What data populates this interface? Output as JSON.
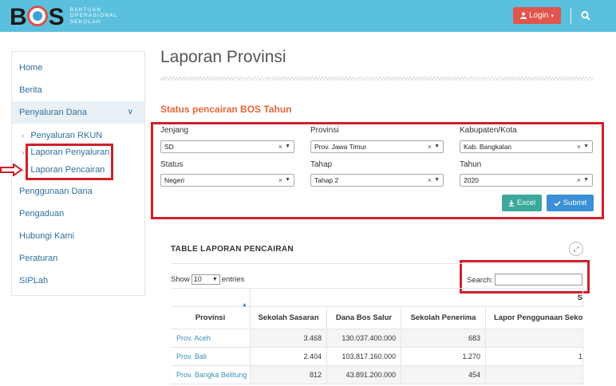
{
  "header": {
    "logo": "BOS",
    "logo_sub": [
      "BANTUAN",
      "OPERASIONAL",
      "SEKOLAH"
    ],
    "login_label": "Login",
    "colors": {
      "bar": "#5bc0de",
      "login": "#e0554d"
    }
  },
  "sidebar": {
    "items": [
      {
        "label": "Home"
      },
      {
        "label": "Berita"
      },
      {
        "label": "Penyaluran Dana"
      },
      {
        "label": "Penggunaan Dana"
      },
      {
        "label": "Pengaduan"
      },
      {
        "label": "Hubungi Kami"
      },
      {
        "label": "Peraturan"
      },
      {
        "label": "SIPLah"
      }
    ],
    "subitems": [
      {
        "label": "Penyaluran RKUN"
      },
      {
        "label": "Laporan Penyaluran"
      },
      {
        "label": "Laporan Pencairan"
      }
    ]
  },
  "main": {
    "title": "Laporan Provinsi",
    "section_title": "Status pencairan BOS Tahun",
    "filters": {
      "jenjang": {
        "label": "Jenjang",
        "value": "SD"
      },
      "provinsi": {
        "label": "Provinsi",
        "value": "Prov. Jawa Timur"
      },
      "kabupaten": {
        "label": "Kabupaten/Kota",
        "value": "Kab. Bangkalan"
      },
      "status": {
        "label": "Status",
        "value": "Negeri"
      },
      "tahap": {
        "label": "Tahap",
        "value": "Tahap 2"
      },
      "tahun": {
        "label": "Tahun",
        "value": "2020"
      }
    },
    "excel_label": "Excel",
    "submit_label": "Submit"
  },
  "table": {
    "title": "TABLE LAPORAN PENCAIRAN",
    "show_label": "Show",
    "show_value": "10",
    "entries_label": "entries",
    "search_label": "Search:",
    "search_value": "",
    "group_header": "S",
    "columns": [
      "Provinsi",
      "Sekolah Sasaran",
      "Dana Bos Salur",
      "Sekolah Penerima",
      "Lapor Penggunaan Sekolah"
    ],
    "rows": [
      [
        "Prov. Aceh",
        "3.468",
        "130.037.400.000",
        "683",
        ""
      ],
      [
        "Prov. Bali",
        "2.404",
        "103.817.160.000",
        "1.270",
        "1"
      ],
      [
        "Prov. Bangka Belitung",
        "812",
        "43.891.200.000",
        "454",
        ""
      ]
    ]
  }
}
